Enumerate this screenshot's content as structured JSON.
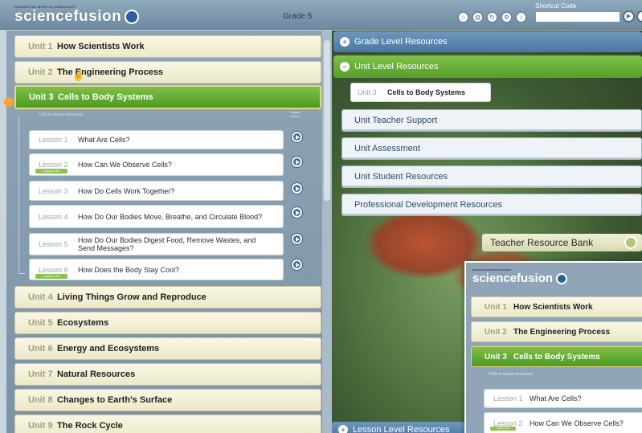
{
  "header": {
    "publisher": "HOUGHTON MIFFLIN HARCOURT",
    "logo": "sciencefusion",
    "grade": "Grade 5",
    "tool_icons": [
      "home-icon",
      "globe-icon",
      "refresh-icon",
      "gear-icon",
      "info-icon"
    ],
    "shortcut_label": "Shortcut Code",
    "shortcut_value": ""
  },
  "left": {
    "units": [
      {
        "num": "Unit 1",
        "title": "How Scientists Work"
      },
      {
        "num": "Unit 2",
        "title": "The Engineering Process"
      },
      {
        "num": "Unit 3",
        "title": "Cells to Body Systems"
      },
      {
        "num": "Unit 4",
        "title": "Living Things Grow and Reproduce"
      },
      {
        "num": "Unit 5",
        "title": "Ecosystems"
      },
      {
        "num": "Unit 6",
        "title": "Energy and Ecosystems"
      },
      {
        "num": "Unit 7",
        "title": "Natural Resources"
      },
      {
        "num": "Unit 8",
        "title": "Changes to Earth's Surface"
      },
      {
        "num": "Unit 9",
        "title": "The Rock Cycle"
      }
    ],
    "hint": "Click to reveal resources.",
    "digital_label": "Digital Lesson",
    "lessons": [
      {
        "num": "Lesson 1",
        "title": "What Are Cells?",
        "badge": ""
      },
      {
        "num": "Lesson 2",
        "title": "How Can We Observe Cells?",
        "badge": "Inquiry Lab"
      },
      {
        "num": "Lesson 3",
        "title": "How Do Cells Work Together?",
        "badge": ""
      },
      {
        "num": "Lesson 4",
        "title": "How Do Our Bodies Move, Breathe, and Circulate Blood?",
        "badge": ""
      },
      {
        "num": "Lesson 5",
        "title": "How Do Our Bodies Digest Food, Remove Wastes, and Send Messages?",
        "badge": ""
      },
      {
        "num": "Lesson 6",
        "title": "How Does the Body Stay Cool?",
        "badge": "Inquiry Lab"
      }
    ]
  },
  "right": {
    "grade_resources": "Grade Level Resources",
    "unit_resources": "Unit Level Resources",
    "current_unit_num": "Unit 3",
    "current_unit_title": "Cells to Body Systems",
    "sub_items": [
      "Unit Teacher Support",
      "Unit Assessment",
      "Unit Student Resources",
      "Professional Development Resources"
    ],
    "teacher_bank": "Teacher Resource Bank",
    "lesson_resources": "Lesson Level Resources"
  },
  "inset": {
    "publisher": "HOUGHTON MIFFLIN HARCOURT",
    "logo": "sciencefusion",
    "units": [
      {
        "num": "Unit 1",
        "title": "How Scientists Work"
      },
      {
        "num": "Unit 2",
        "title": "The Engineering Process"
      },
      {
        "num": "Unit 3",
        "title": "Cells to Body Systems"
      }
    ],
    "hint": "Click to reveal resources.",
    "lessons": [
      {
        "num": "Lesson 1",
        "title": "What Are Cells?",
        "badge": ""
      },
      {
        "num": "Lesson 2",
        "title": "How Can We Observe Cells?",
        "badge": "Inquiry Lab"
      }
    ]
  }
}
